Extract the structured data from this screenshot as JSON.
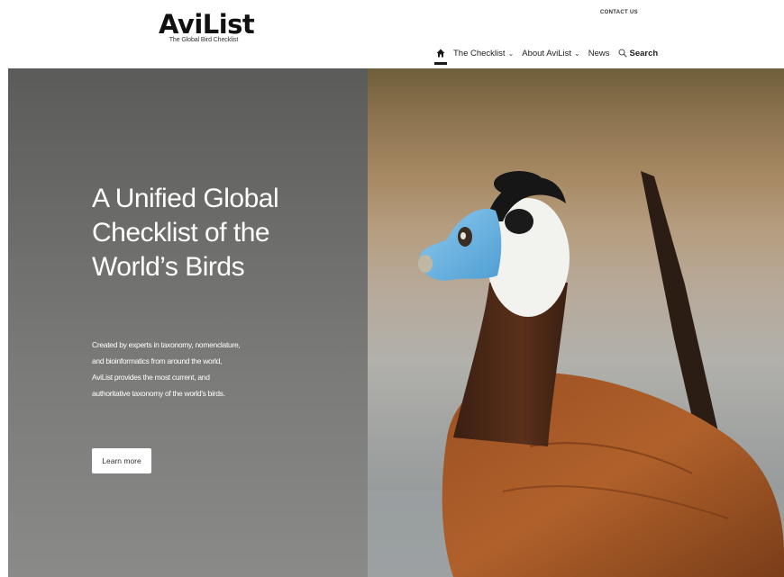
{
  "header": {
    "logo_title": "AviList",
    "logo_subtitle": "The Global Bird Checklist",
    "contact_label": "CONTACT US",
    "nav": {
      "home_icon": "home-icon",
      "items": [
        {
          "label": "The Checklist",
          "has_dropdown": true
        },
        {
          "label": "About AviList",
          "has_dropdown": true
        },
        {
          "label": "News",
          "has_dropdown": false
        }
      ],
      "search_label": "Search",
      "search_icon": "search-icon"
    }
  },
  "hero": {
    "title_lines": [
      "A Unified Global",
      "Checklist of the",
      "World’s Birds"
    ],
    "description_lines": [
      "Created by experts in taxonomy, nomenclature,",
      "and bioinformatics from around the world,",
      "AviList provides the most current, and",
      "authoritative taxonomy of the world's birds."
    ],
    "button_label": "Learn more"
  }
}
